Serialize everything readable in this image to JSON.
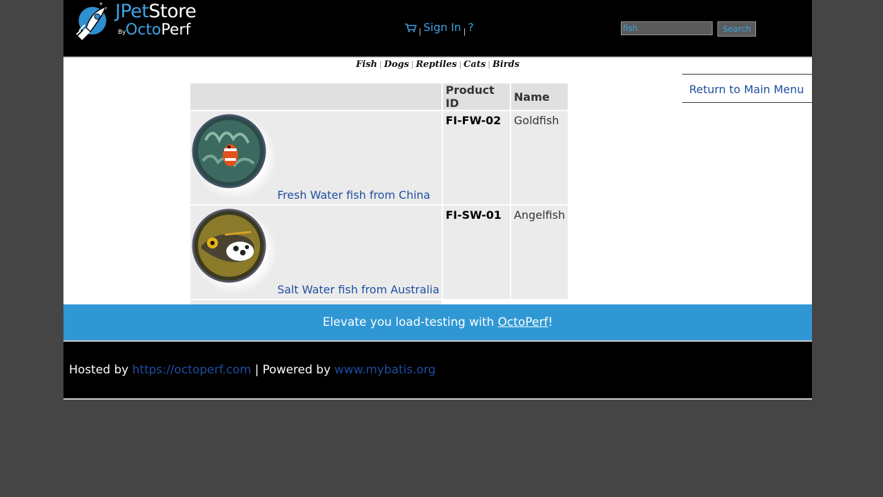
{
  "header": {
    "logo": {
      "jpet": "JPet",
      "store": "Store",
      "by": "By",
      "octo": "Octo",
      "perf": "Perf"
    },
    "menu": {
      "cart_icon": "cart-icon",
      "sep": "|",
      "sign_in": "Sign In",
      "help": "?"
    },
    "search": {
      "value": "fish",
      "button_label": "Search"
    }
  },
  "quicklinks": [
    "Fish",
    "Dogs",
    "Reptiles",
    "Cats",
    "Birds"
  ],
  "back_link": "Return to Main Menu",
  "table": {
    "headers": [
      "",
      "Product ID",
      "Name"
    ],
    "rows": [
      {
        "description": "Fresh Water fish from China",
        "product_id": "FI-FW-02",
        "name": "Goldfish",
        "image": "clownfish-image"
      },
      {
        "description": "Salt Water fish from Australia",
        "product_id": "FI-SW-01",
        "name": "Angelfish",
        "image": "triggerfish-image"
      }
    ]
  },
  "banner": {
    "text_before": "Elevate you load-testing with ",
    "link": "OctoPerf",
    "text_after": "!"
  },
  "footer": {
    "hosted_by": "Hosted by ",
    "hosted_link": "https://octoperf.com",
    "sep": " | Powered by ",
    "powered_link": "www.mybatis.org"
  },
  "colors": {
    "accent": "#3da3e0",
    "link": "#1e4da0",
    "banner": "#2f98d4",
    "background": "#454545"
  }
}
